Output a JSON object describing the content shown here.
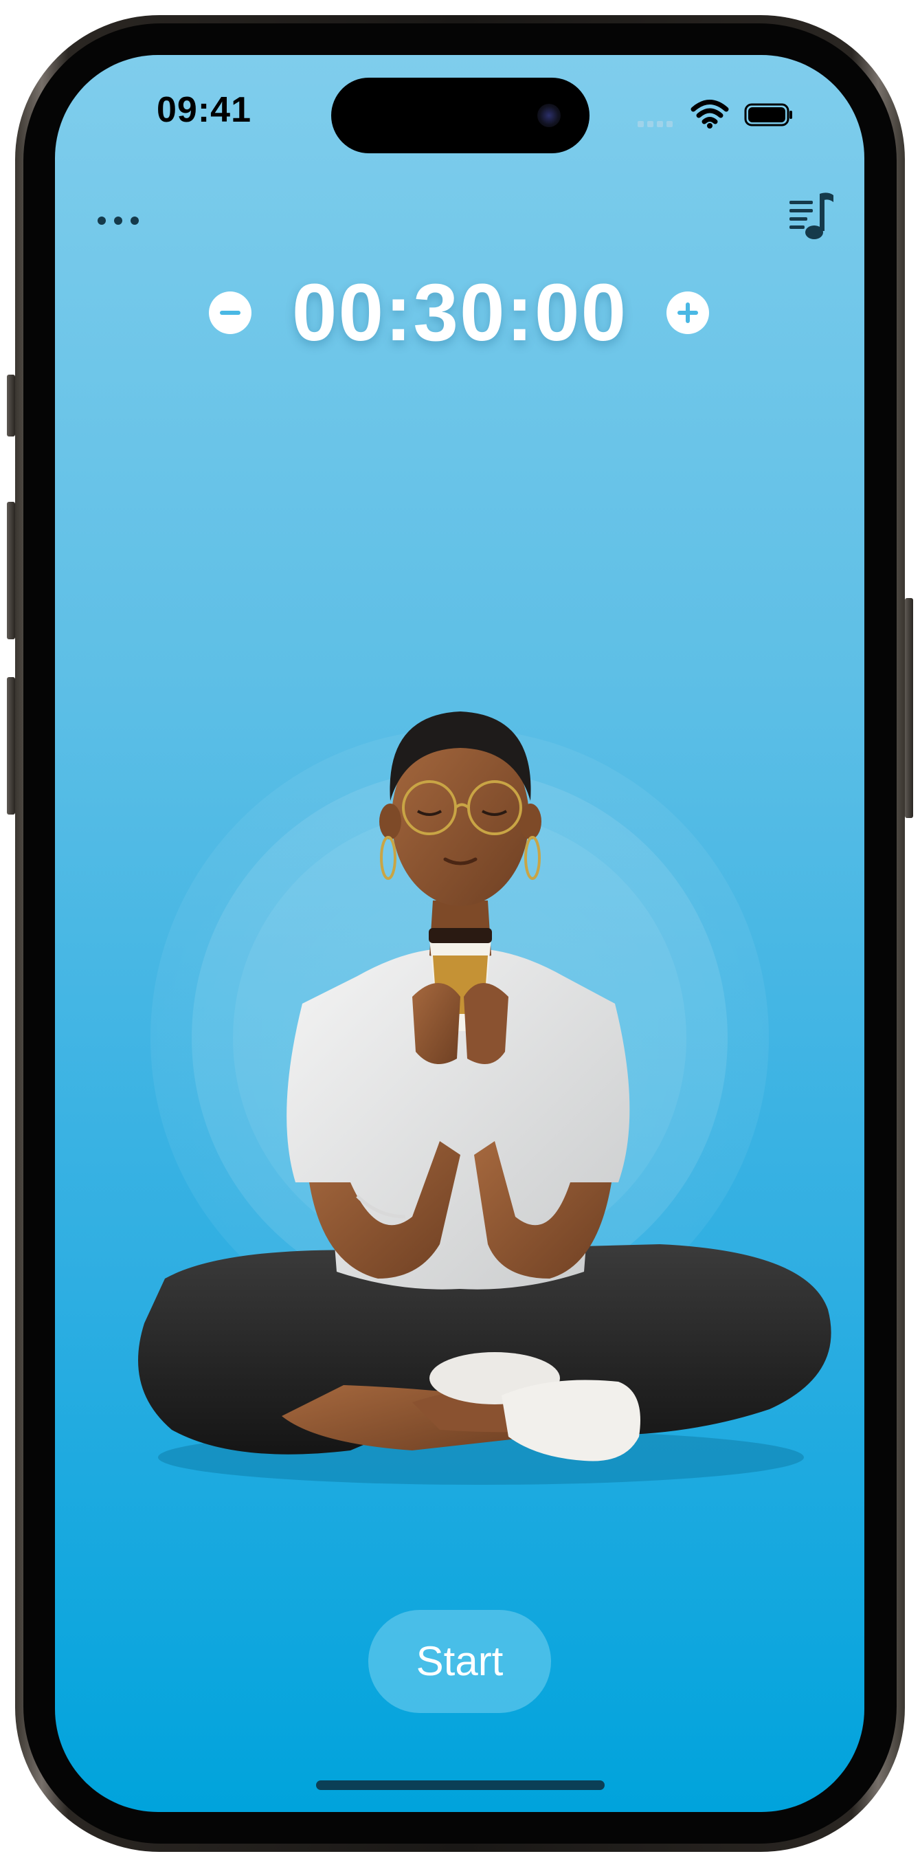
{
  "status_bar": {
    "time": "09:41"
  },
  "toolbar": {
    "more_icon": "more-icon",
    "music_icon": "music-list-icon"
  },
  "timer": {
    "value": "00:30:00",
    "decrease_icon": "minus-icon",
    "increase_icon": "plus-icon"
  },
  "illustration": {
    "subject": "meditating-person-with-coffee"
  },
  "actions": {
    "start_label": "Start"
  },
  "colors": {
    "background_top": "#7fcdec",
    "background_bottom": "#00a3dc",
    "timer_text": "#ffffff",
    "start_button": "#78d2f0"
  }
}
